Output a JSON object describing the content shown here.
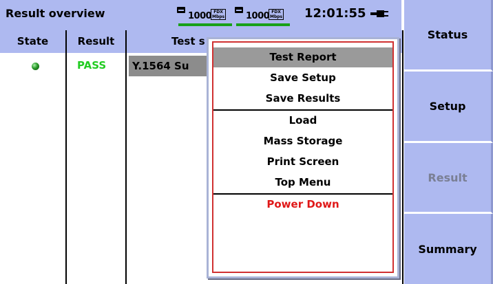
{
  "header": {
    "title": "Result overview",
    "ports": [
      {
        "speed": "1000",
        "duplex_top": "FDX",
        "duplex_bottom": "Mbps"
      },
      {
        "speed": "1000",
        "duplex_top": "FDX",
        "duplex_bottom": "Mbps"
      }
    ],
    "time": "12:01:55",
    "battery_icon": "ac-power-plug-icon"
  },
  "table": {
    "columns": [
      "State",
      "Result",
      "Test s"
    ],
    "rows": [
      {
        "state_icon": "green-led-icon",
        "result": "PASS",
        "test": "Y.1564 Su"
      }
    ]
  },
  "menu": {
    "items": [
      {
        "label": "Test Report"
      },
      {
        "label": "Save Setup"
      },
      {
        "label": "Save Results"
      },
      {
        "label": "Load"
      },
      {
        "label": "Mass Storage"
      },
      {
        "label": "Print Screen"
      },
      {
        "label": "Top Menu"
      },
      {
        "label": "Power Down"
      }
    ],
    "selected": "Test Report"
  },
  "sidebar": {
    "buttons": [
      {
        "label": "Status"
      },
      {
        "label": "Setup"
      },
      {
        "label": "Result"
      },
      {
        "label": "Summary"
      }
    ]
  },
  "colors": {
    "header_bg": "#aeb9f0",
    "pass": "#22cc22",
    "power_down": "#e01818",
    "link_led": "#18a018"
  }
}
